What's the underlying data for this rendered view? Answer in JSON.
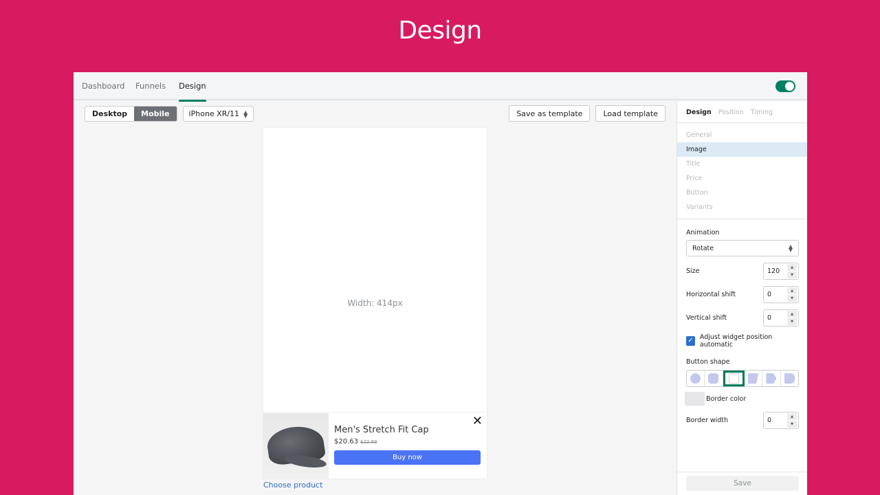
{
  "heading": "Design",
  "nav": {
    "tabs": [
      {
        "label": "Dashboard"
      },
      {
        "label": "Funnels"
      },
      {
        "label": "Design",
        "active": true
      }
    ],
    "enabled_toggle": true
  },
  "toolbar": {
    "view_modes": [
      "Desktop",
      "Mobile"
    ],
    "active_view": "Mobile",
    "device": "iPhone XR/11",
    "save_template": "Save as template",
    "load_template": "Load template"
  },
  "preview": {
    "width_label": "Width: 414px",
    "product": {
      "title": "Men's Stretch Fit Cap",
      "price": "$20.63",
      "compare_price": "$22.69",
      "buy_label": "Buy now",
      "close_glyph": "✕"
    },
    "choose_product": "Choose product"
  },
  "panel": {
    "tabs": [
      {
        "label": "Design",
        "active": true
      },
      {
        "label": "Position"
      },
      {
        "label": "Timing"
      }
    ],
    "sections": [
      {
        "label": "General"
      },
      {
        "label": "Image",
        "active": true
      },
      {
        "label": "Title"
      },
      {
        "label": "Price"
      },
      {
        "label": "Button"
      },
      {
        "label": "Variants"
      }
    ],
    "animation_label": "Animation",
    "animation_value": "Rotate",
    "size_label": "Size",
    "size_value": "120",
    "hshift_label": "Horizontal shift",
    "hshift_value": "0",
    "vshift_label": "Vertical shift",
    "vshift_value": "0",
    "adjust_label": "Adjust widget position automatic",
    "adjust_checked": true,
    "button_shape_label": "Button shape",
    "button_shapes": [
      "circle",
      "rounded-square",
      "square",
      "trapezoid",
      "arrow",
      "rounded-right"
    ],
    "active_shape": "square",
    "shape_color": "#c3c8ec",
    "border_color_label": "Border color",
    "border_color": "#e6e6e8",
    "border_width_label": "Border width",
    "border_width_value": "0",
    "save_label": "Save"
  }
}
